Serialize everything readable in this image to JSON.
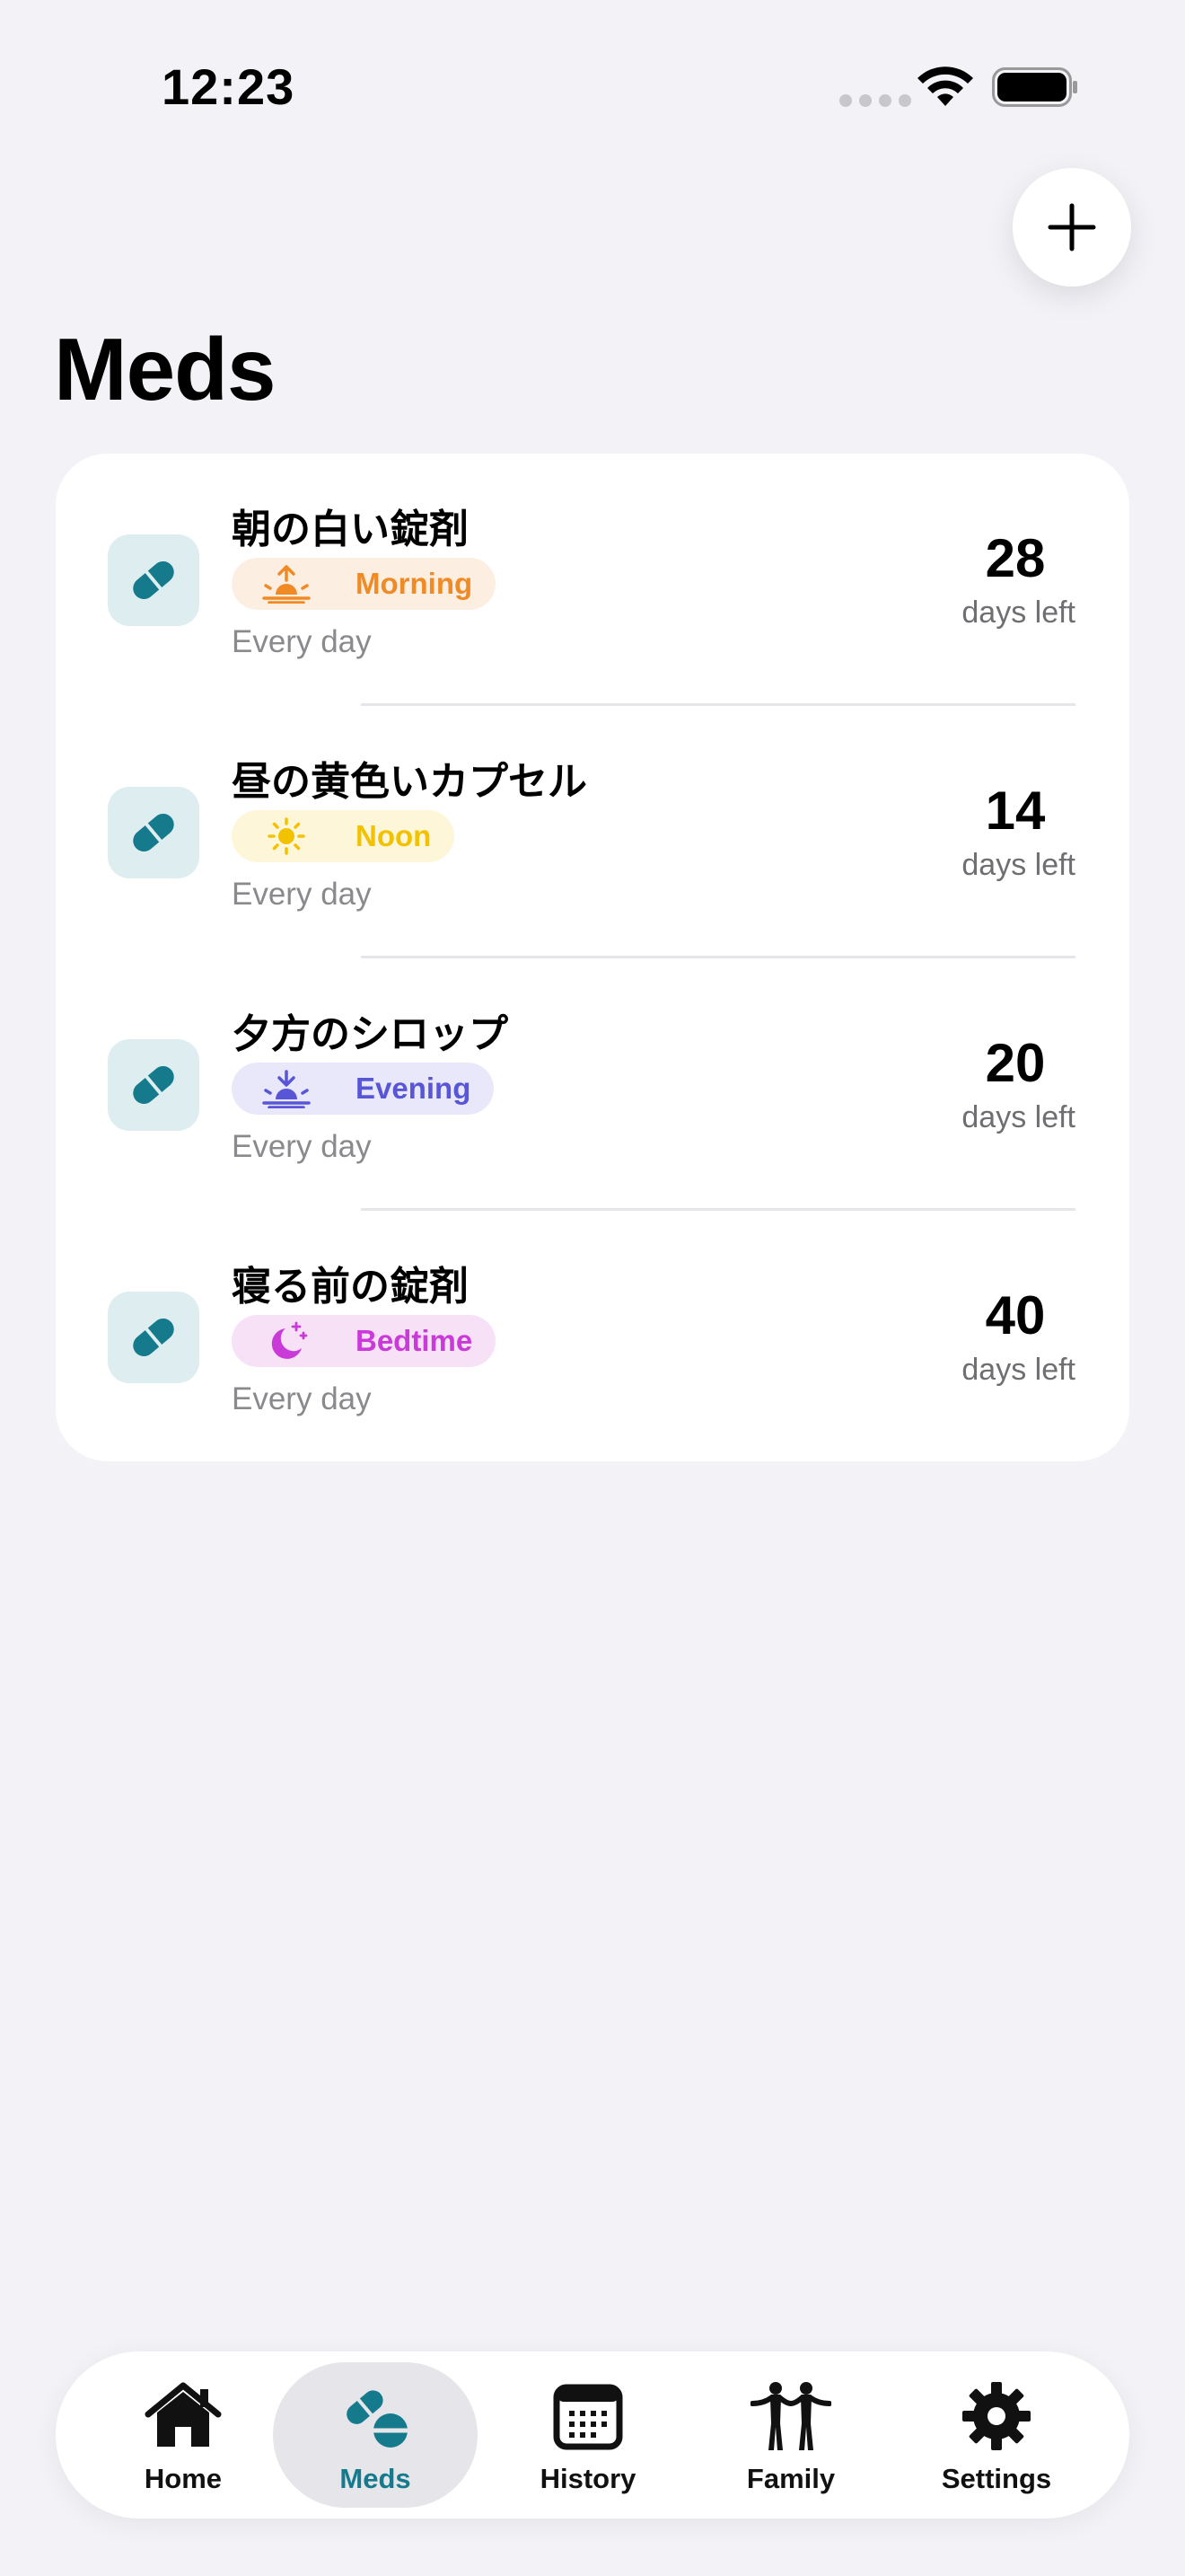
{
  "status_bar": {
    "time": "12:23"
  },
  "header": {
    "title": "Meds",
    "add_icon": "plus-icon"
  },
  "medications": [
    {
      "name": "朝の白い錠剤",
      "time_label": "Morning",
      "time_icon": "sunrise-icon",
      "chip_color": "#f08a24",
      "chip_bg": "#fdeee2",
      "frequency": "Every day",
      "days_left": "28",
      "days_label": "days left"
    },
    {
      "name": "昼の黄色いカプセル",
      "time_label": "Noon",
      "time_icon": "sun-icon",
      "chip_color": "#f2c200",
      "chip_bg": "#fdf6d9",
      "frequency": "Every day",
      "days_left": "14",
      "days_label": "days left"
    },
    {
      "name": "夕方のシロップ",
      "time_label": "Evening",
      "time_icon": "sunset-icon",
      "chip_color": "#5856d6",
      "chip_bg": "#e9e8fb",
      "frequency": "Every day",
      "days_left": "20",
      "days_label": "days left"
    },
    {
      "name": "寝る前の錠剤",
      "time_label": "Bedtime",
      "time_icon": "moon-stars-icon",
      "chip_color": "#c93ad9",
      "chip_bg": "#f7e1f7",
      "frequency": "Every day",
      "days_left": "40",
      "days_label": "days left"
    }
  ],
  "colors": {
    "accent": "#147a8c",
    "pill_tile_bg": "#deeef0"
  },
  "tab_bar": {
    "selected": "Meds",
    "tabs": [
      {
        "label": "Home",
        "icon": "house-icon"
      },
      {
        "label": "Meds",
        "icon": "pills-icon"
      },
      {
        "label": "History",
        "icon": "calendar-icon"
      },
      {
        "label": "Family",
        "icon": "people-icon"
      },
      {
        "label": "Settings",
        "icon": "gear-icon"
      }
    ]
  }
}
